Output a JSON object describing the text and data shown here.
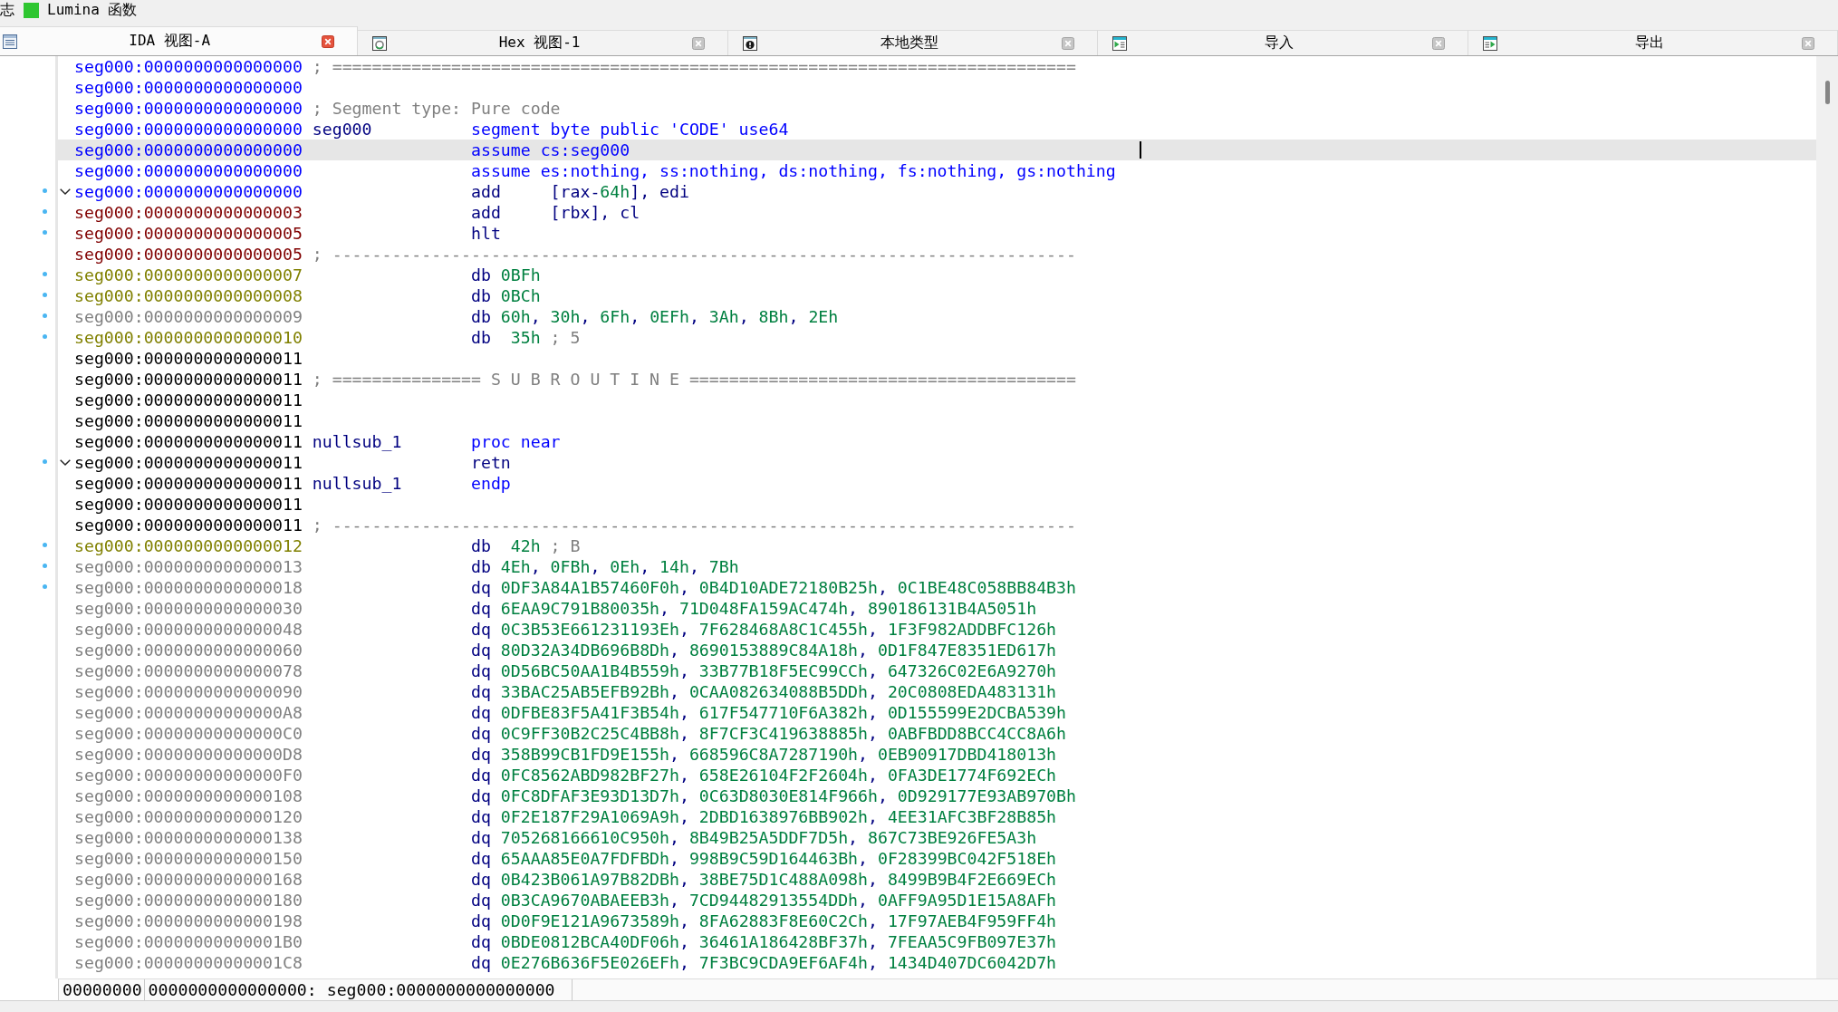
{
  "top_bar": {
    "items": [
      {
        "label": "志",
        "kind": "label"
      },
      {
        "label": "Lumina 函数",
        "kind": "icon-label"
      }
    ]
  },
  "tabs": [
    {
      "label": "IDA 视图-A",
      "kind": "disassembly",
      "selected": true
    },
    {
      "label": "Hex 视图-1",
      "kind": "hex",
      "selected": false
    },
    {
      "label": "本地类型",
      "kind": "types",
      "selected": false
    },
    {
      "label": "导入",
      "kind": "imports",
      "selected": false
    },
    {
      "label": "导出",
      "kind": "exports",
      "selected": false
    }
  ],
  "listing": {
    "lines": [
      {
        "address": "seg000:0000000000000000",
        "color": "#0000ff",
        "kind": "comment",
        "comment": "; ===========================================================================",
        "marked": false,
        "selected": false
      },
      {
        "address": "seg000:0000000000000000",
        "color": "#0000ff",
        "kind": "blank",
        "marked": false,
        "selected": false
      },
      {
        "address": "seg000:0000000000000000",
        "color": "#0000ff",
        "kind": "comment",
        "comment": "; Segment type: Pure code",
        "marked": false,
        "selected": false
      },
      {
        "address": "seg000:0000000000000000",
        "color": "#0000ff",
        "kind": "directive",
        "label": "seg000",
        "mnemonic": "segment",
        "operands": [
          {
            "text": "byte public 'CODE' use64",
            "kind": "keyword"
          }
        ],
        "marked": false,
        "selected": false
      },
      {
        "address": "seg000:0000000000000000",
        "color": "#0000ff",
        "kind": "directive",
        "mnemonic": "assume",
        "operands": [
          {
            "text": "cs:seg000",
            "kind": "keyword"
          }
        ],
        "marked": false,
        "selected": true
      },
      {
        "address": "seg000:0000000000000000",
        "color": "#0000ff",
        "kind": "directive",
        "mnemonic": "assume",
        "operands": [
          {
            "text": "es:nothing, ss:nothing, ds:nothing, fs:nothing, gs:nothing",
            "kind": "keyword"
          }
        ],
        "marked": false,
        "selected": false
      },
      {
        "address": "seg000:0000000000000000",
        "color": "#0000ff",
        "kind": "instruction",
        "mnemonic": "add",
        "operands": [
          {
            "text": "[rax-",
            "kind": "plain"
          },
          {
            "text": "64h",
            "kind": "number"
          },
          {
            "text": "], edi",
            "kind": "plain"
          }
        ],
        "marked": true,
        "selected": false,
        "expanded": true
      },
      {
        "address": "seg000:0000000000000003",
        "color": "#800000",
        "kind": "instruction",
        "mnemonic": "add",
        "operands": [
          {
            "text": "[rbx], cl",
            "kind": "plain"
          }
        ],
        "marked": true,
        "selected": false
      },
      {
        "address": "seg000:0000000000000005",
        "color": "#800000",
        "kind": "instruction",
        "mnemonic": "hlt",
        "marked": true,
        "selected": false
      },
      {
        "address": "seg000:0000000000000005",
        "color": "#800000",
        "kind": "comment",
        "comment": "; ---------------------------------------------------------------------------",
        "marked": false,
        "selected": false
      },
      {
        "address": "seg000:0000000000000007",
        "color": "#808000",
        "kind": "data",
        "mnemonic": "db",
        "operands": [
          {
            "text": "0BFh",
            "kind": "number"
          }
        ],
        "marked": true,
        "selected": false
      },
      {
        "address": "seg000:0000000000000008",
        "color": "#808000",
        "kind": "data",
        "mnemonic": "db",
        "operands": [
          {
            "text": "0BCh",
            "kind": "number"
          }
        ],
        "marked": true,
        "selected": false
      },
      {
        "address": "seg000:0000000000000009",
        "color": "#808080",
        "kind": "data",
        "mnemonic": "db",
        "operands": [
          {
            "text": "60h",
            "kind": "number"
          },
          {
            "text": ", ",
            "kind": "plain"
          },
          {
            "text": "30h",
            "kind": "number"
          },
          {
            "text": ", ",
            "kind": "plain"
          },
          {
            "text": "6Fh",
            "kind": "number"
          },
          {
            "text": ", ",
            "kind": "plain"
          },
          {
            "text": "0EFh",
            "kind": "number"
          },
          {
            "text": ", ",
            "kind": "plain"
          },
          {
            "text": "3Ah",
            "kind": "number"
          },
          {
            "text": ", ",
            "kind": "plain"
          },
          {
            "text": "8Bh",
            "kind": "number"
          },
          {
            "text": ", ",
            "kind": "plain"
          },
          {
            "text": "2Eh",
            "kind": "number"
          }
        ],
        "marked": true,
        "selected": false
      },
      {
        "address": "seg000:0000000000000010",
        "color": "#808000",
        "kind": "data",
        "mnemonic": "db",
        "operands": [
          {
            "text": " 35h",
            "kind": "number"
          },
          {
            "text": " ; 5",
            "kind": "comment"
          }
        ],
        "marked": true,
        "selected": false
      },
      {
        "address": "seg000:0000000000000011",
        "color": "#000000",
        "kind": "blank",
        "marked": false,
        "selected": false
      },
      {
        "address": "seg000:0000000000000011",
        "color": "#000000",
        "kind": "comment",
        "comment": "; =============== S U B R O U T I N E =======================================",
        "marked": false,
        "selected": false
      },
      {
        "address": "seg000:0000000000000011",
        "color": "#000000",
        "kind": "blank",
        "marked": false,
        "selected": false
      },
      {
        "address": "seg000:0000000000000011",
        "color": "#000000",
        "kind": "blank",
        "marked": false,
        "selected": false
      },
      {
        "address": "seg000:0000000000000011",
        "color": "#000000",
        "kind": "directive",
        "label": "nullsub_1",
        "mnemonic": "proc",
        "operands": [
          {
            "text": "near",
            "kind": "keyword"
          }
        ],
        "marked": false,
        "selected": false
      },
      {
        "address": "seg000:0000000000000011",
        "color": "#000000",
        "kind": "instruction",
        "mnemonic": "retn",
        "marked": true,
        "selected": false,
        "expanded": true
      },
      {
        "address": "seg000:0000000000000011",
        "color": "#000000",
        "kind": "directive",
        "label": "nullsub_1",
        "mnemonic": "endp",
        "marked": false,
        "selected": false
      },
      {
        "address": "seg000:0000000000000011",
        "color": "#000000",
        "kind": "blank",
        "marked": false,
        "selected": false
      },
      {
        "address": "seg000:0000000000000011",
        "color": "#000000",
        "kind": "comment",
        "comment": "; ---------------------------------------------------------------------------",
        "marked": false,
        "selected": false
      },
      {
        "address": "seg000:0000000000000012",
        "color": "#808000",
        "kind": "data",
        "mnemonic": "db",
        "operands": [
          {
            "text": " 42h",
            "kind": "number"
          },
          {
            "text": " ; B",
            "kind": "comment"
          }
        ],
        "marked": true,
        "selected": false
      },
      {
        "address": "seg000:0000000000000013",
        "color": "#808080",
        "kind": "data",
        "mnemonic": "db",
        "operands": [
          {
            "text": "4Eh",
            "kind": "number"
          },
          {
            "text": ", ",
            "kind": "plain"
          },
          {
            "text": "0FBh",
            "kind": "number"
          },
          {
            "text": ", ",
            "kind": "plain"
          },
          {
            "text": "0Eh",
            "kind": "number"
          },
          {
            "text": ", ",
            "kind": "plain"
          },
          {
            "text": "14h",
            "kind": "number"
          },
          {
            "text": ", ",
            "kind": "plain"
          },
          {
            "text": "7Bh",
            "kind": "number"
          }
        ],
        "marked": true,
        "selected": false
      },
      {
        "address": "seg000:0000000000000018",
        "color": "#808080",
        "kind": "data",
        "mnemonic": "dq",
        "operands": [
          {
            "text": "0DF3A84A1B57460F0h",
            "kind": "number"
          },
          {
            "text": ", ",
            "kind": "plain"
          },
          {
            "text": "0B4D10ADE72180B25h",
            "kind": "number"
          },
          {
            "text": ", ",
            "kind": "plain"
          },
          {
            "text": "0C1BE48C058BB84B3h",
            "kind": "number"
          }
        ],
        "marked": true,
        "selected": false
      },
      {
        "address": "seg000:0000000000000030",
        "color": "#808080",
        "kind": "data",
        "mnemonic": "dq",
        "operands": [
          {
            "text": "6EAA9C791B80035h",
            "kind": "number"
          },
          {
            "text": ", ",
            "kind": "plain"
          },
          {
            "text": "71D048FA159AC474h",
            "kind": "number"
          },
          {
            "text": ", ",
            "kind": "plain"
          },
          {
            "text": "890186131B4A5051h",
            "kind": "number"
          }
        ],
        "marked": false,
        "selected": false
      },
      {
        "address": "seg000:0000000000000048",
        "color": "#808080",
        "kind": "data",
        "mnemonic": "dq",
        "operands": [
          {
            "text": "0C3B53E661231193Eh",
            "kind": "number"
          },
          {
            "text": ", ",
            "kind": "plain"
          },
          {
            "text": "7F628468A8C1C455h",
            "kind": "number"
          },
          {
            "text": ", ",
            "kind": "plain"
          },
          {
            "text": "1F3F982ADDBFC126h",
            "kind": "number"
          }
        ],
        "marked": false,
        "selected": false
      },
      {
        "address": "seg000:0000000000000060",
        "color": "#808080",
        "kind": "data",
        "mnemonic": "dq",
        "operands": [
          {
            "text": "80D32A34DB696B8Dh",
            "kind": "number"
          },
          {
            "text": ", ",
            "kind": "plain"
          },
          {
            "text": "8690153889C84A18h",
            "kind": "number"
          },
          {
            "text": ", ",
            "kind": "plain"
          },
          {
            "text": "0D1F847E8351ED617h",
            "kind": "number"
          }
        ],
        "marked": false,
        "selected": false
      },
      {
        "address": "seg000:0000000000000078",
        "color": "#808080",
        "kind": "data",
        "mnemonic": "dq",
        "operands": [
          {
            "text": "0D56BC50AA1B4B559h",
            "kind": "number"
          },
          {
            "text": ", ",
            "kind": "plain"
          },
          {
            "text": "33B77B18F5EC99CCh",
            "kind": "number"
          },
          {
            "text": ", ",
            "kind": "plain"
          },
          {
            "text": "647326C02E6A9270h",
            "kind": "number"
          }
        ],
        "marked": false,
        "selected": false
      },
      {
        "address": "seg000:0000000000000090",
        "color": "#808080",
        "kind": "data",
        "mnemonic": "dq",
        "operands": [
          {
            "text": "33BAC25AB5EFB92Bh",
            "kind": "number"
          },
          {
            "text": ", ",
            "kind": "plain"
          },
          {
            "text": "0CAA082634088B5DDh",
            "kind": "number"
          },
          {
            "text": ", ",
            "kind": "plain"
          },
          {
            "text": "20C0808EDA483131h",
            "kind": "number"
          }
        ],
        "marked": false,
        "selected": false
      },
      {
        "address": "seg000:00000000000000A8",
        "color": "#808080",
        "kind": "data",
        "mnemonic": "dq",
        "operands": [
          {
            "text": "0DFBE83F5A41F3B54h",
            "kind": "number"
          },
          {
            "text": ", ",
            "kind": "plain"
          },
          {
            "text": "617F547710F6A382h",
            "kind": "number"
          },
          {
            "text": ", ",
            "kind": "plain"
          },
          {
            "text": "0D155599E2DCBA539h",
            "kind": "number"
          }
        ],
        "marked": false,
        "selected": false
      },
      {
        "address": "seg000:00000000000000C0",
        "color": "#808080",
        "kind": "data",
        "mnemonic": "dq",
        "operands": [
          {
            "text": "0C9FF30B2C25C4BB8h",
            "kind": "number"
          },
          {
            "text": ", ",
            "kind": "plain"
          },
          {
            "text": "8F7CF3C419638885h",
            "kind": "number"
          },
          {
            "text": ", ",
            "kind": "plain"
          },
          {
            "text": "0ABFBDD8BCC4CC8A6h",
            "kind": "number"
          }
        ],
        "marked": false,
        "selected": false
      },
      {
        "address": "seg000:00000000000000D8",
        "color": "#808080",
        "kind": "data",
        "mnemonic": "dq",
        "operands": [
          {
            "text": "358B99CB1FD9E155h",
            "kind": "number"
          },
          {
            "text": ", ",
            "kind": "plain"
          },
          {
            "text": "668596C8A7287190h",
            "kind": "number"
          },
          {
            "text": ", ",
            "kind": "plain"
          },
          {
            "text": "0EB90917DBD418013h",
            "kind": "number"
          }
        ],
        "marked": false,
        "selected": false
      },
      {
        "address": "seg000:00000000000000F0",
        "color": "#808080",
        "kind": "data",
        "mnemonic": "dq",
        "operands": [
          {
            "text": "0FC8562ABD982BF27h",
            "kind": "number"
          },
          {
            "text": ", ",
            "kind": "plain"
          },
          {
            "text": "658E26104F2F2604h",
            "kind": "number"
          },
          {
            "text": ", ",
            "kind": "plain"
          },
          {
            "text": "0FA3DE1774F692ECh",
            "kind": "number"
          }
        ],
        "marked": false,
        "selected": false
      },
      {
        "address": "seg000:0000000000000108",
        "color": "#808080",
        "kind": "data",
        "mnemonic": "dq",
        "operands": [
          {
            "text": "0FC8DFAF3E93D13D7h",
            "kind": "number"
          },
          {
            "text": ", ",
            "kind": "plain"
          },
          {
            "text": "0C63D8030E814F966h",
            "kind": "number"
          },
          {
            "text": ", ",
            "kind": "plain"
          },
          {
            "text": "0D929177E93AB970Bh",
            "kind": "number"
          }
        ],
        "marked": false,
        "selected": false
      },
      {
        "address": "seg000:0000000000000120",
        "color": "#808080",
        "kind": "data",
        "mnemonic": "dq",
        "operands": [
          {
            "text": "0F2E187F29A1069A9h",
            "kind": "number"
          },
          {
            "text": ", ",
            "kind": "plain"
          },
          {
            "text": "2DBD1638976BB902h",
            "kind": "number"
          },
          {
            "text": ", ",
            "kind": "plain"
          },
          {
            "text": "4EE31AFC3BF28B85h",
            "kind": "number"
          }
        ],
        "marked": false,
        "selected": false
      },
      {
        "address": "seg000:0000000000000138",
        "color": "#808080",
        "kind": "data",
        "mnemonic": "dq",
        "operands": [
          {
            "text": "705268166610C950h",
            "kind": "number"
          },
          {
            "text": ", ",
            "kind": "plain"
          },
          {
            "text": "8B49B25A5DDF7D5h",
            "kind": "number"
          },
          {
            "text": ", ",
            "kind": "plain"
          },
          {
            "text": "867C73BE926FE5A3h",
            "kind": "number"
          }
        ],
        "marked": false,
        "selected": false
      },
      {
        "address": "seg000:0000000000000150",
        "color": "#808080",
        "kind": "data",
        "mnemonic": "dq",
        "operands": [
          {
            "text": "65AAA85E0A7FDFBDh",
            "kind": "number"
          },
          {
            "text": ", ",
            "kind": "plain"
          },
          {
            "text": "998B9C59D164463Bh",
            "kind": "number"
          },
          {
            "text": ", ",
            "kind": "plain"
          },
          {
            "text": "0F28399BC042F518Eh",
            "kind": "number"
          }
        ],
        "marked": false,
        "selected": false
      },
      {
        "address": "seg000:0000000000000168",
        "color": "#808080",
        "kind": "data",
        "mnemonic": "dq",
        "operands": [
          {
            "text": "0B423B061A97B82DBh",
            "kind": "number"
          },
          {
            "text": ", ",
            "kind": "plain"
          },
          {
            "text": "38BE75D1C488A098h",
            "kind": "number"
          },
          {
            "text": ", ",
            "kind": "plain"
          },
          {
            "text": "8499B9B4F2E669ECh",
            "kind": "number"
          }
        ],
        "marked": false,
        "selected": false
      },
      {
        "address": "seg000:0000000000000180",
        "color": "#808080",
        "kind": "data",
        "mnemonic": "dq",
        "operands": [
          {
            "text": "0B3CA9670ABAEEB3h",
            "kind": "number"
          },
          {
            "text": ", ",
            "kind": "plain"
          },
          {
            "text": "7CD94482913554DDh",
            "kind": "number"
          },
          {
            "text": ", ",
            "kind": "plain"
          },
          {
            "text": "0AFF9A95D1E15A8AFh",
            "kind": "number"
          }
        ],
        "marked": false,
        "selected": false
      },
      {
        "address": "seg000:0000000000000198",
        "color": "#808080",
        "kind": "data",
        "mnemonic": "dq",
        "operands": [
          {
            "text": "0D0F9E121A9673589h",
            "kind": "number"
          },
          {
            "text": ", ",
            "kind": "plain"
          },
          {
            "text": "8FA62883F8E60C2Ch",
            "kind": "number"
          },
          {
            "text": ", ",
            "kind": "plain"
          },
          {
            "text": "17F97AEB4F959FF4h",
            "kind": "number"
          }
        ],
        "marked": false,
        "selected": false
      },
      {
        "address": "seg000:00000000000001B0",
        "color": "#808080",
        "kind": "data",
        "mnemonic": "dq",
        "operands": [
          {
            "text": "0BDE0812BCA40DF06h",
            "kind": "number"
          },
          {
            "text": ", ",
            "kind": "plain"
          },
          {
            "text": "36461A186428BF37h",
            "kind": "number"
          },
          {
            "text": ", ",
            "kind": "plain"
          },
          {
            "text": "7FEAA5C9FB097E37h",
            "kind": "number"
          }
        ],
        "marked": false,
        "selected": false
      },
      {
        "address": "seg000:00000000000001C8",
        "color": "#808080",
        "kind": "data",
        "mnemonic": "dq",
        "operands": [
          {
            "text": "0E276B636F5E026EFh",
            "kind": "number"
          },
          {
            "text": ", ",
            "kind": "plain"
          },
          {
            "text": "7F3BC9CDA9EF6AF4h",
            "kind": "number"
          },
          {
            "text": ", ",
            "kind": "plain"
          },
          {
            "text": "1434D407DC6042D7h",
            "kind": "number"
          }
        ],
        "marked": false,
        "selected": false
      }
    ]
  },
  "status_bar": {
    "cells": [
      "00000000",
      "0000000000000000: seg000:0000000000000000"
    ]
  }
}
